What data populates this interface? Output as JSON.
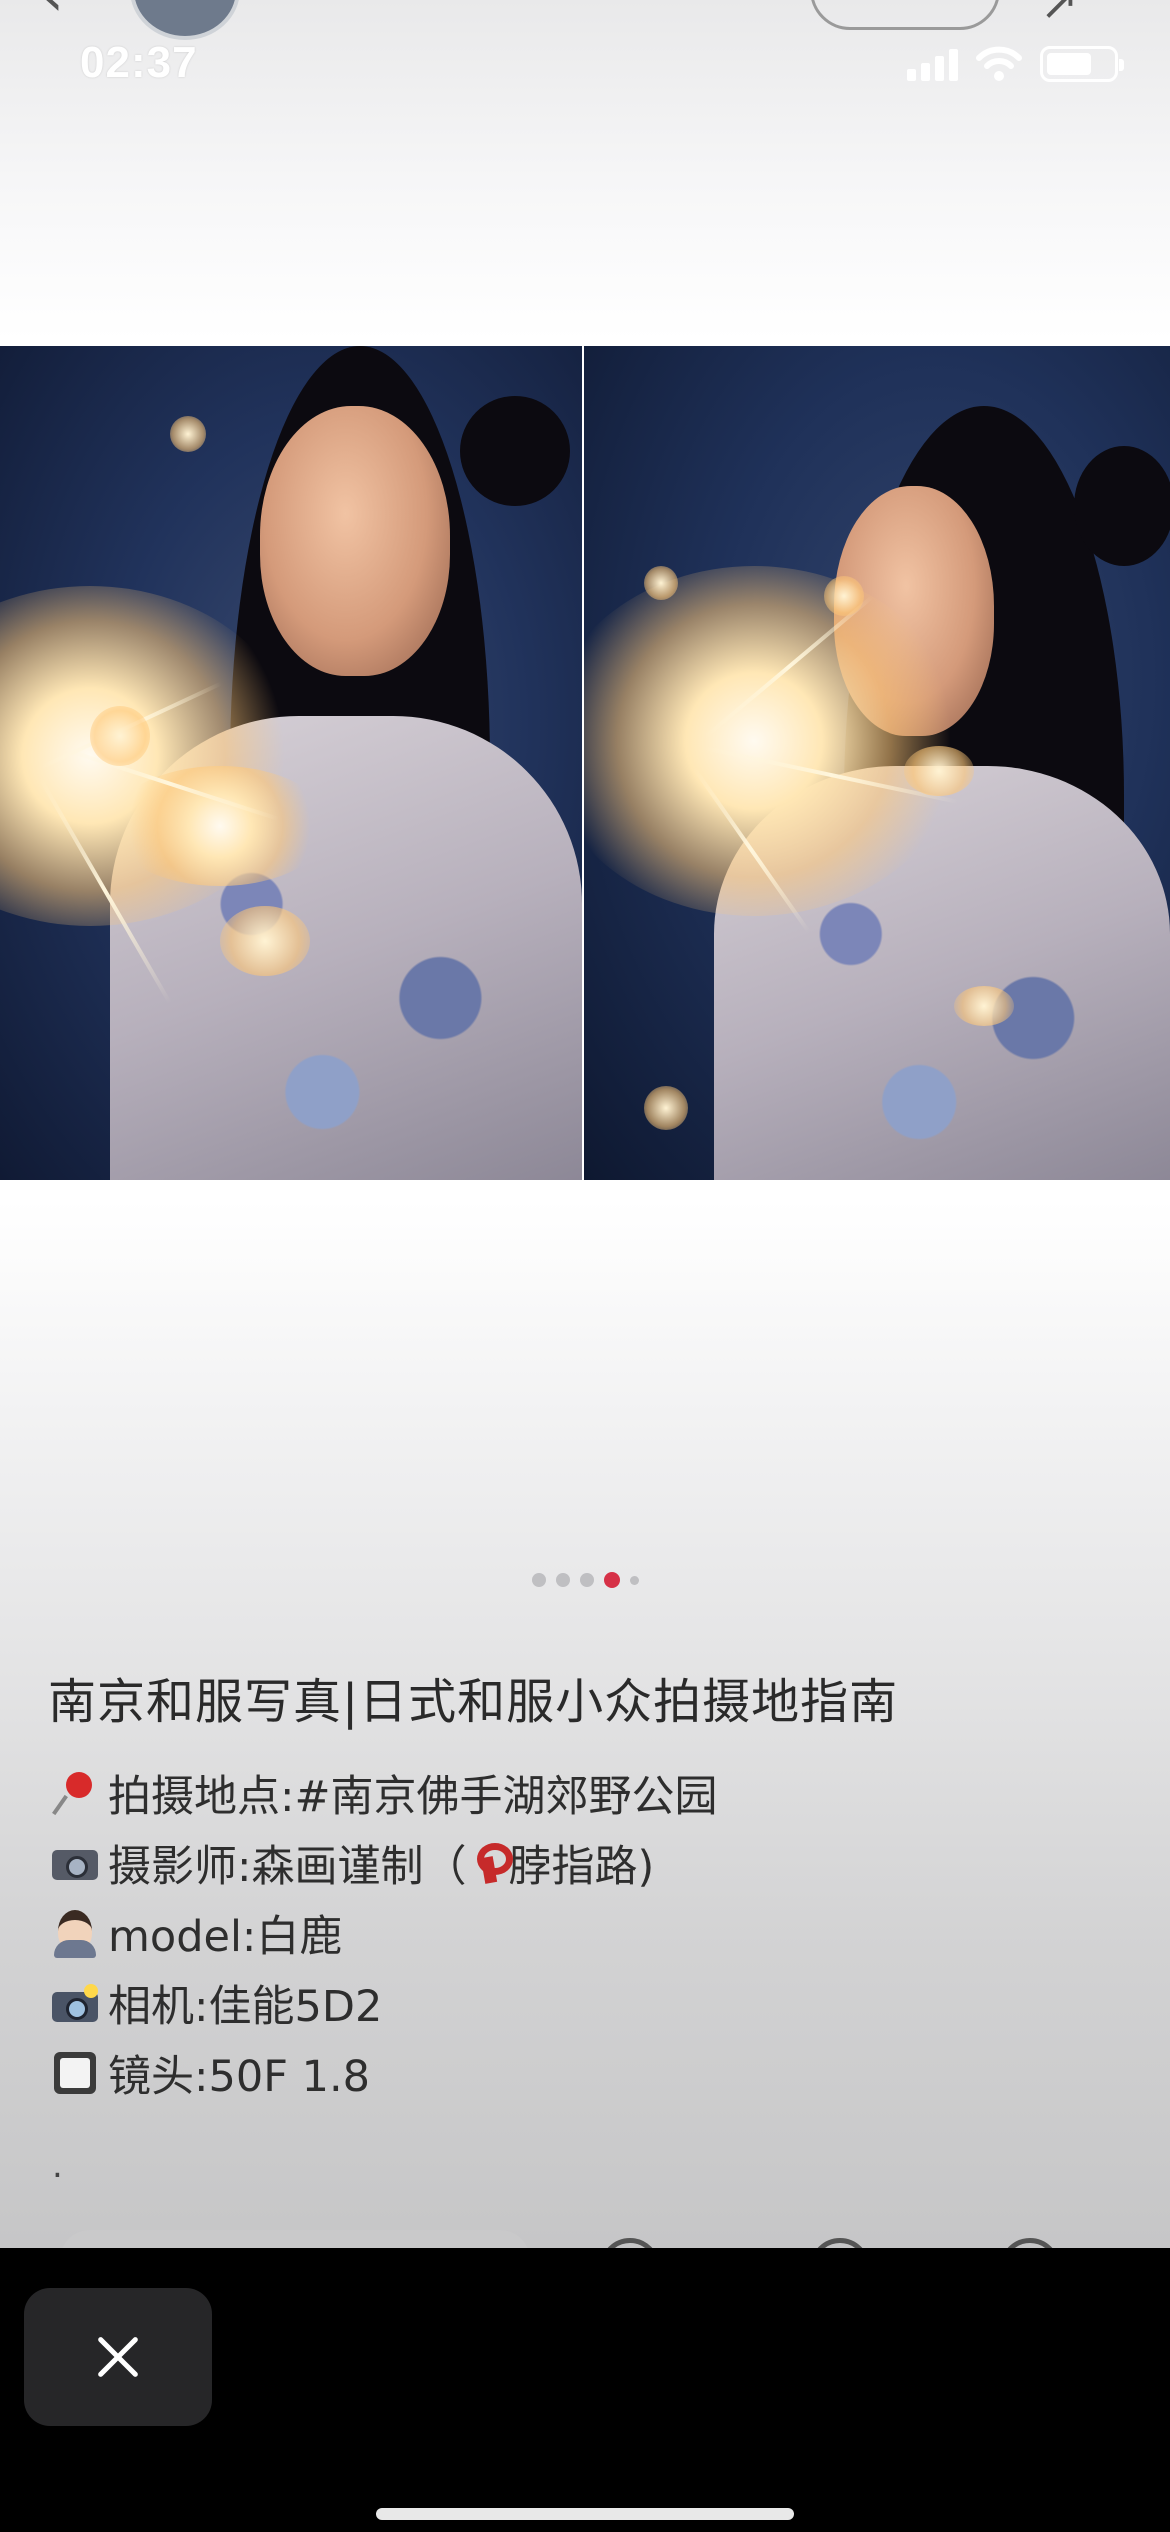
{
  "status_bar": {
    "time": "02:37"
  },
  "carousel": {
    "page_count": 5,
    "active_index": 3
  },
  "note": {
    "title": "南京和服写真|日式和服小众拍摄地指南",
    "lines": [
      {
        "icon": "pushpin-icon",
        "text": "拍摄地点:#南京佛手湖郊野公园"
      },
      {
        "icon": "camera-icon",
        "text": "摄影师:森画谨制（",
        "text_after_icon": "脖指路)"
      },
      {
        "icon": "person-icon",
        "text": "model:白鹿"
      },
      {
        "icon": "camera-with-flash-icon",
        "text": "相机:佳能5D2"
      },
      {
        "icon": "square-icon",
        "text": "镜头:50F  1.8"
      }
    ],
    "trailing": "."
  }
}
